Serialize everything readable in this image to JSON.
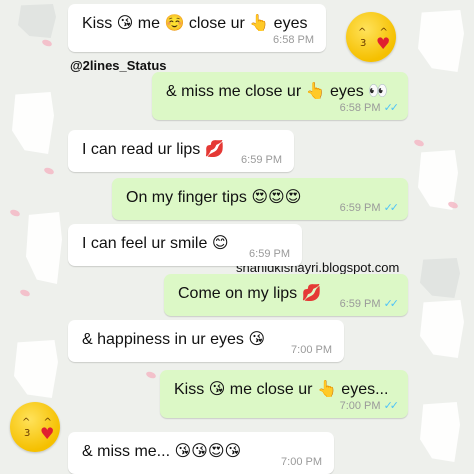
{
  "watermark_handle": "@2lines_Status",
  "watermark_site": "shahidkishayri.blogspot.com",
  "colors": {
    "incoming_bubble": "#ffffff",
    "outgoing_bubble": "#dcf8c6",
    "timestamp": "#9a9a9a",
    "read_ticks": "#4fc3f7"
  },
  "messages": [
    {
      "text": "Kiss 😘 me ☺️ close ur 👆 eyes",
      "time": "6:58 PM"
    },
    {
      "text": "& miss me close ur 👆 eyes 👀",
      "time": "6:58 PM",
      "ticks": "✓✓"
    },
    {
      "text": "I can read ur lips 💋",
      "time": "6:59 PM"
    },
    {
      "text": "On my finger tips 😍😍😍",
      "time": "6:59 PM",
      "ticks": "✓✓"
    },
    {
      "text": "I can feel ur smile 😊",
      "time": "6:59 PM"
    },
    {
      "text": "Come on my lips 💋",
      "time": "6:59 PM",
      "ticks": "✓✓"
    },
    {
      "text": "& happiness in ur eyes 😘",
      "time": "7:00 PM"
    },
    {
      "text": "Kiss 😘 me close ur 👆 eyes...",
      "time": "7:00 PM",
      "ticks": "✓✓"
    },
    {
      "text": "& miss me... 😘😘😍😘",
      "time": "7:00 PM"
    }
  ]
}
